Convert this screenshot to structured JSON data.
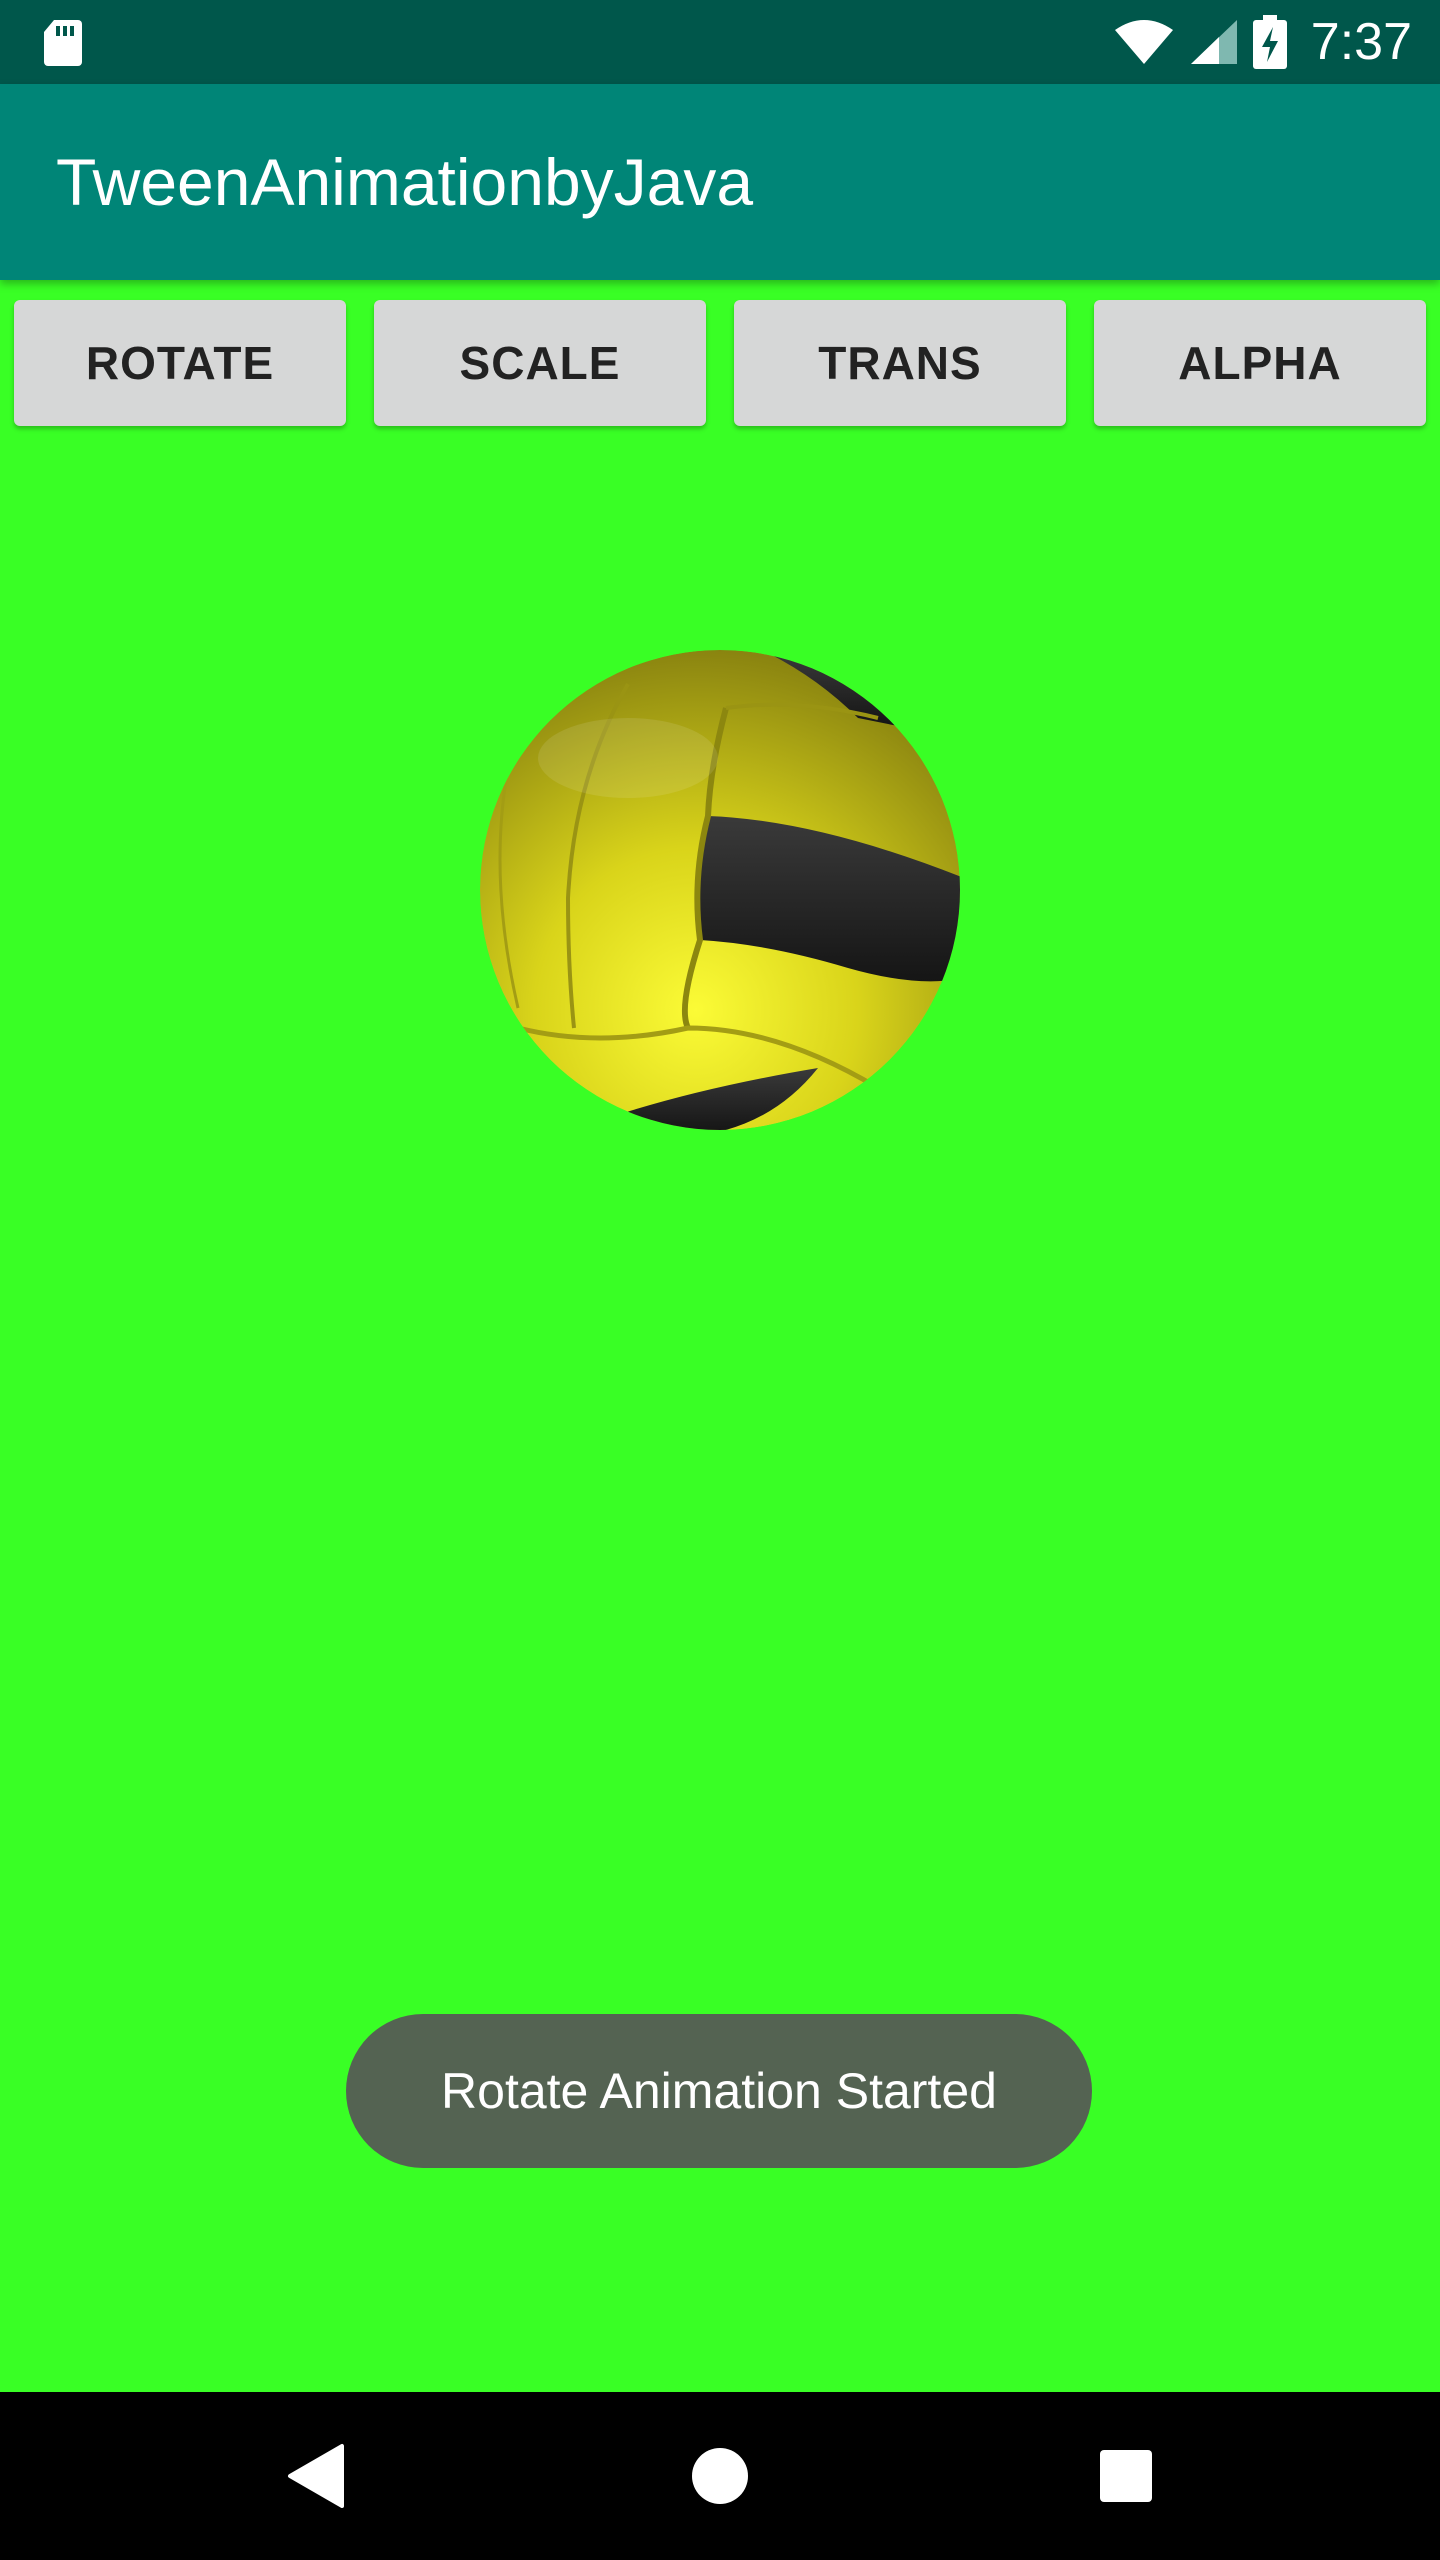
{
  "status_bar": {
    "time": "7:37",
    "icons": [
      "sd-card-icon",
      "wifi-icon",
      "cell-signal-icon",
      "battery-charging-icon"
    ]
  },
  "app_bar": {
    "title": "TweenAnimationbyJava",
    "background": "#008577"
  },
  "buttons": [
    {
      "label": "ROTATE"
    },
    {
      "label": "SCALE"
    },
    {
      "label": "TRANS"
    },
    {
      "label": "ALPHA"
    }
  ],
  "content": {
    "background": "#39ff25",
    "image": "volleyball-image"
  },
  "toast": {
    "message": "Rotate Animation Started"
  },
  "nav_bar": {
    "icons": [
      "back-icon",
      "home-icon",
      "recent-apps-icon"
    ]
  }
}
